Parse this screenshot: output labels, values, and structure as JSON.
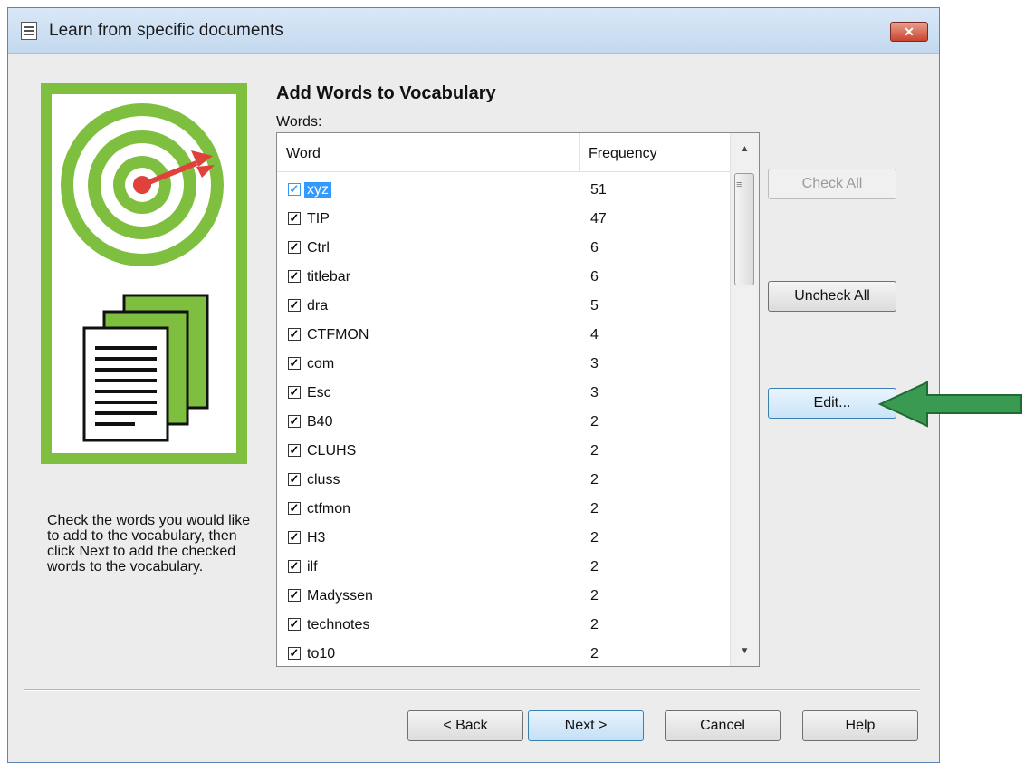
{
  "dialog": {
    "title": "Learn from specific documents",
    "close_glyph": "✕"
  },
  "content": {
    "heading": "Add Words to Vocabulary",
    "words_label": "Words:",
    "description": "Check the words you would like to add to the vocabulary, then click Next to add the checked words to the vocabulary."
  },
  "list": {
    "columns": {
      "word": "Word",
      "frequency": "Frequency"
    },
    "rows": [
      {
        "word": "xyz",
        "frequency": "51",
        "checked": true,
        "selected": true
      },
      {
        "word": "TIP",
        "frequency": "47",
        "checked": true
      },
      {
        "word": "Ctrl",
        "frequency": "6",
        "checked": true
      },
      {
        "word": "titlebar",
        "frequency": "6",
        "checked": true
      },
      {
        "word": "dra",
        "frequency": "5",
        "checked": true
      },
      {
        "word": "CTFMON",
        "frequency": "4",
        "checked": true
      },
      {
        "word": "com",
        "frequency": "3",
        "checked": true
      },
      {
        "word": "Esc",
        "frequency": "3",
        "checked": true
      },
      {
        "word": "B40",
        "frequency": "2",
        "checked": true
      },
      {
        "word": "CLUHS",
        "frequency": "2",
        "checked": true
      },
      {
        "word": "cluss",
        "frequency": "2",
        "checked": true
      },
      {
        "word": "ctfmon",
        "frequency": "2",
        "checked": true
      },
      {
        "word": "H3",
        "frequency": "2",
        "checked": true
      },
      {
        "word": "ilf",
        "frequency": "2",
        "checked": true
      },
      {
        "word": "Madyssen",
        "frequency": "2",
        "checked": true
      },
      {
        "word": "technotes",
        "frequency": "2",
        "checked": true
      },
      {
        "word": "to10",
        "frequency": "2",
        "checked": true
      }
    ]
  },
  "side_buttons": {
    "check_all": "Check All",
    "uncheck_all": "Uncheck All",
    "edit": "Edit..."
  },
  "footer_buttons": {
    "back": "< Back",
    "next": "Next >",
    "cancel": "Cancel",
    "help": "Help"
  },
  "colors": {
    "illustration_green": "#7fbf3f",
    "target_red": "#e0413a",
    "annotation_arrow": "#3a9a52",
    "selection_blue": "#3399ff"
  },
  "icons": {
    "title": "document-icon",
    "close": "close-icon",
    "illustration": "target-and-documents-illustration",
    "annotation": "green-arrow-pointer"
  }
}
